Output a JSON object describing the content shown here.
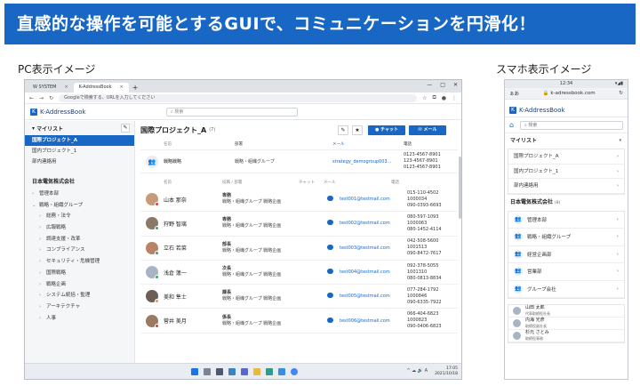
{
  "banner": {
    "headline": "直感的な操作を可能とするGUIで、コミュニケーションを円滑化！"
  },
  "captions": {
    "pc": "PC表示イメージ",
    "sp": "スマホ表示イメージ"
  },
  "colors": {
    "accent": "#1967c4",
    "banner": "#1967c4"
  },
  "pc": {
    "tabs": [
      {
        "label": "W SYSTEM",
        "active": false
      },
      {
        "label": "K-AddressBook",
        "active": true
      }
    ],
    "window_controls": [
      "—",
      "□",
      "✕"
    ],
    "url_placeholder": "Googleで検索する、URLを入力してください",
    "app_name": "K-AddressBook",
    "search_placeholder": "検索",
    "sidebar": {
      "mylist_title": "マイリスト",
      "mylist": [
        {
          "label": "国際プロジェクト_A",
          "selected": true
        },
        {
          "label": "国内プロジェクト_1",
          "selected": false
        },
        {
          "label": "部内連絡用",
          "selected": false
        }
      ],
      "org_title": "日本電気株式会社",
      "tree": [
        {
          "label": "管理本部",
          "arrow": "›",
          "sub": false
        },
        {
          "label": "戦略・組織グループ",
          "arrow": "⌄",
          "sub": false
        },
        {
          "label": "総務・法令",
          "arrow": "›",
          "sub": true
        },
        {
          "label": "広報戦略",
          "arrow": "›",
          "sub": true
        },
        {
          "label": "調達支援・改革",
          "arrow": "›",
          "sub": true
        },
        {
          "label": "コンプライアンス",
          "arrow": "›",
          "sub": true
        },
        {
          "label": "セキュリティ・危機管理",
          "arrow": "›",
          "sub": true
        },
        {
          "label": "国際戦略",
          "arrow": "›",
          "sub": true
        },
        {
          "label": "戦略企画",
          "arrow": "›",
          "sub": true
        },
        {
          "label": "システム統括・監理",
          "arrow": "›",
          "sub": true
        },
        {
          "label": "アーキテクチャ",
          "arrow": "›",
          "sub": true
        },
        {
          "label": "人事",
          "arrow": "›",
          "sub": true
        }
      ]
    },
    "main": {
      "title": "国際プロジェクト_A",
      "count": "(7)",
      "chat_button": "チャット",
      "mail_button": "メール",
      "group_headers": {
        "name": "名前",
        "dept": "部署",
        "mail": "メール",
        "tel": "電話"
      },
      "group": {
        "name": "戦略戦略",
        "dept": "戦略・組織グループ",
        "mail": "strategy_demogroup003...",
        "tels": [
          "0123-4567-8901",
          "123-4567-8901",
          "0123-4567-8901"
        ]
      },
      "people_headers": {
        "name": "名前",
        "role_dept": "役職 / 部署",
        "chat": "チャット",
        "mail": "メール",
        "tel": "電話"
      },
      "people": [
        {
          "name": "山本 那奈",
          "title": "専務",
          "dept": "戦略・組織グループ 戦略企画",
          "mail": "test001@testmail.com",
          "tels": [
            "015-110-4502",
            "1000034",
            "090-0393-6693"
          ],
          "avatar": "#c79a7a",
          "status": "#e23b3b"
        },
        {
          "name": "狩野 智璃",
          "title": "専務",
          "dept": "戦略・組織グループ 戦略企画",
          "mail": "test002@testmail.com",
          "tels": [
            "080-597-1093",
            "1000063",
            "080-1452-4114"
          ],
          "avatar": "#8a7868",
          "status": "#3aa655"
        },
        {
          "name": "立石 若菜",
          "title": "部長",
          "dept": "戦略・組織グループ 戦略企画",
          "mail": "test003@testmail.com",
          "tels": [
            "042-508-5600",
            "1001513",
            "090-8472-7617"
          ],
          "avatar": "#b88466",
          "status": "#3aa655"
        },
        {
          "name": "浅倉 蓮一",
          "title": "次長",
          "dept": "戦略・組織グループ 戦略企画",
          "mail": "test004@testmail.com",
          "tels": [
            "092-378-5055",
            "1001310",
            "080-0813-8834"
          ],
          "avatar": "#a8b4c4",
          "status": "#3aa655"
        },
        {
          "name": "美和 隼士",
          "title": "課長",
          "dept": "戦略・組織グループ 戦略企画",
          "mail": "test005@testmail.com",
          "tels": [
            "077-284-1792",
            "1000846",
            "090-6335-7922"
          ],
          "avatar": "#6d5f55",
          "status": "#e2a23b"
        },
        {
          "name": "菅井 美月",
          "title": "係長",
          "dept": "戦略・組織グループ 戦略企画",
          "mail": "test006@testmail.com",
          "tels": [
            "066-404-6823",
            "1000823",
            "090-0406-6823"
          ],
          "avatar": "#9b7a62",
          "status": "#e23b3b"
        }
      ]
    },
    "taskbar": {
      "time": "17:05",
      "date": "2021/10/18",
      "tray": "^ ☁ 🔊 A"
    }
  },
  "sp": {
    "status_time": "12:34",
    "status_icons": "▾◢▮",
    "url_left": "ぁあ",
    "url": "k-adressbook.com",
    "url_icons": "🔒",
    "reload": "↻",
    "app_name": "K-AddressBook",
    "search_placeholder": "検索",
    "mylist_title": "マイリスト",
    "mylist": [
      "国際プロジェクト_A",
      "国内プロジェクト_1",
      "部内連絡用"
    ],
    "org_title": "日本電気株式会社",
    "org_count": "(8)",
    "groups": [
      "管理本部",
      "戦略・組織グループ",
      "経営企画部",
      "営業部",
      "グループ会社"
    ],
    "people": [
      {
        "name": "山田 太郎",
        "title": "代表取締役社長",
        "avatar": "#a8b4c4"
      },
      {
        "name": "内海 光彦",
        "title": "取締役副社長",
        "avatar": "#a8b4c4"
      },
      {
        "name": "杉元 さとみ",
        "title": "取締役専務",
        "avatar": "#a8b4c4"
      }
    ]
  }
}
